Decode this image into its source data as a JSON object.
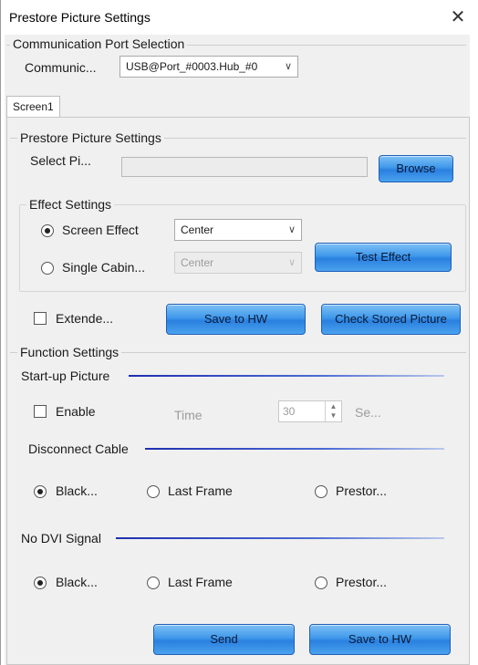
{
  "window": {
    "title": "Prestore Picture Settings",
    "close_glyph": "✕"
  },
  "comm": {
    "group_label": "Communication Port Selection",
    "port_label": "Communic...",
    "port_value": "USB@Port_#0003.Hub_#0"
  },
  "tabs": [
    {
      "label": "Screen1"
    }
  ],
  "prestore": {
    "group_label": "Prestore Picture Settings",
    "select_label": "Select Pi...",
    "select_value": "",
    "browse_label": "Browse",
    "effect": {
      "group_label": "Effect Settings",
      "screen_effect_label": "Screen Effect",
      "screen_effect_value": "Center",
      "single_cabinet_label": "Single Cabin...",
      "single_cabinet_value": "Center",
      "test_effect_label": "Test Effect",
      "selected": "screen"
    },
    "extended_label": "Extende...",
    "extended_checked": false,
    "save_hw_label": "Save to HW",
    "check_stored_label": "Check Stored Picture"
  },
  "function": {
    "group_label": "Function Settings",
    "startup": {
      "label": "Start-up Picture",
      "enable_label": "Enable",
      "enable_checked": false,
      "time_label": "Time",
      "time_value": "30",
      "time_unit": "Se..."
    },
    "disconnect": {
      "label": "Disconnect Cable",
      "options": [
        "Black...",
        "Last Frame",
        "Prestor..."
      ],
      "selected": 0
    },
    "no_dvi": {
      "label": "No DVI Signal",
      "options": [
        "Black...",
        "Last Frame",
        "Prestor..."
      ],
      "selected": 0
    }
  },
  "footer": {
    "send_label": "Send",
    "save_hw_label": "Save to HW"
  },
  "colors": {
    "button_blue": "#3f98ea",
    "separator_blue": "#1e2fb0",
    "background": "#f0f0f0"
  }
}
